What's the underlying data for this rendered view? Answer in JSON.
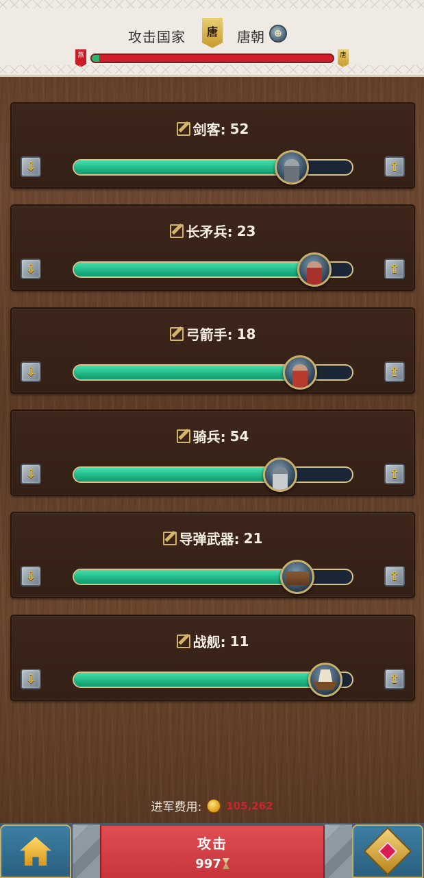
{
  "header": {
    "title": "攻击国家",
    "banner_char": "唐",
    "target_name": "唐朝",
    "info_icon": "globe-info-icon",
    "flag_left_char": "燕",
    "flag_right_char": "唐",
    "strength_ratio": 0.03
  },
  "units": [
    {
      "name": "剑客:",
      "count": "52",
      "fill": 0.78,
      "icon": "swordsman-icon"
    },
    {
      "name": "长矛兵:",
      "count": "23",
      "fill": 0.86,
      "icon": "spearman-icon"
    },
    {
      "name": "弓箭手:",
      "count": "18",
      "fill": 0.81,
      "icon": "archer-icon"
    },
    {
      "name": "骑兵:",
      "count": "54",
      "fill": 0.74,
      "icon": "cavalry-icon"
    },
    {
      "name": "导弹武器:",
      "count": "21",
      "fill": 0.8,
      "icon": "catapult-icon"
    },
    {
      "name": "战舰:",
      "count": "11",
      "fill": 0.9,
      "icon": "warship-icon"
    }
  ],
  "controls": {
    "down_glyph": "⇩",
    "up_glyph": "⇧"
  },
  "footer": {
    "cost_label": "进军费用:",
    "cost_value": "105,262",
    "attack_label": "攻击",
    "attack_cost": "997"
  },
  "colors": {
    "slider_fill": "#1fb585",
    "slider_track": "#1b2637",
    "attack_button": "#d0393e",
    "cost_value": "#c9252c"
  }
}
